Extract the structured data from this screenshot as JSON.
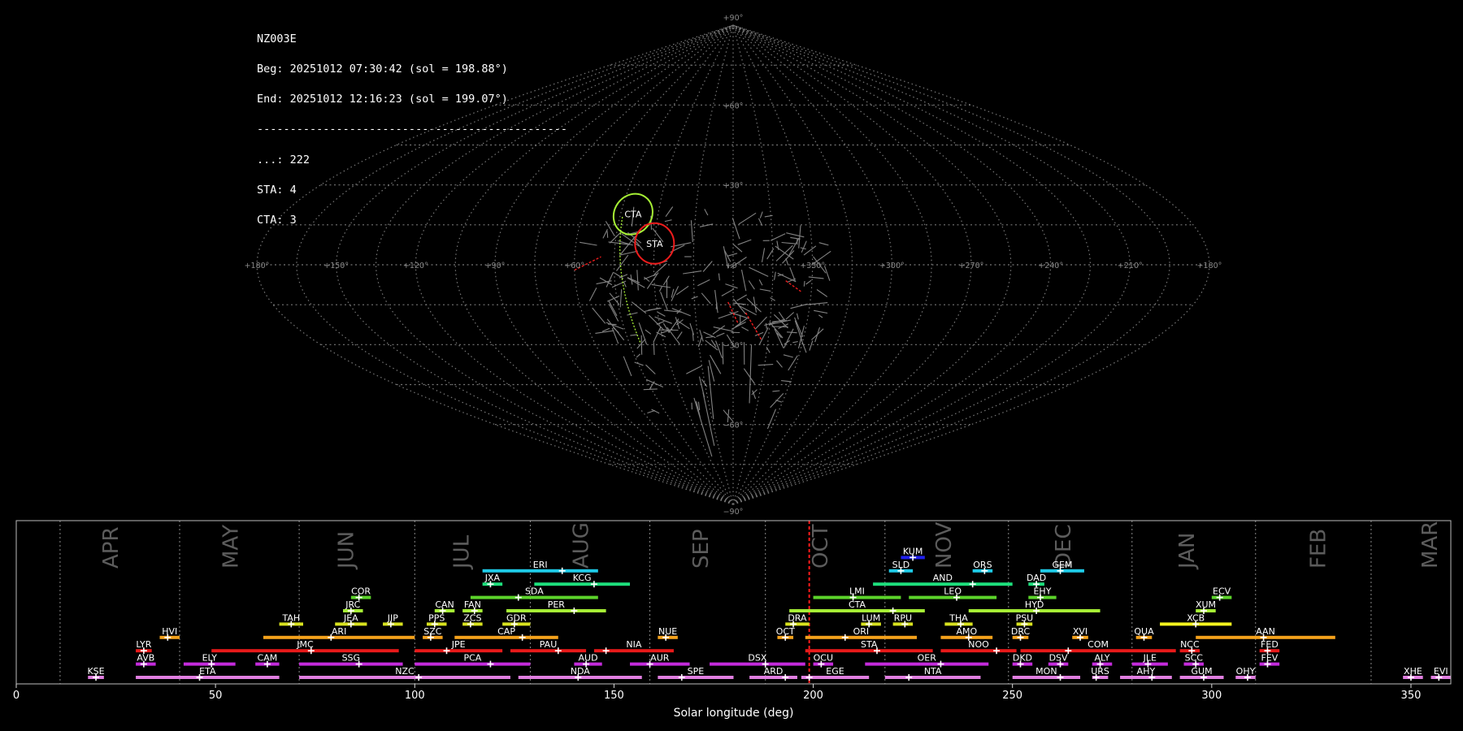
{
  "info": {
    "camera": "NZ003E",
    "begin": "Beg: 20251012 07:30:42 (sol = 198.88°)",
    "end": "End: 20251012 12:16:23 (sol = 199.07°)",
    "separator": "-----------------------------------------------",
    "sporadic": "...: 222",
    "sta": "STA: 4",
    "cta": "CTA: 3"
  },
  "colors": {
    "background": "#000000",
    "frame": "#bbbbbb",
    "grid": "#777777",
    "current_sol": "#ff1a1a",
    "month_text": "#5c5c5c",
    "trails": "#9a9a9a"
  },
  "chart_data": [
    {
      "type": "scatter",
      "projection": "sinusoidal",
      "center_longitude": 0,
      "lat_ticks": [
        {
          "value": 90,
          "label": "+90°"
        },
        {
          "value": 60,
          "label": "+60°"
        },
        {
          "value": 30,
          "label": "+30°"
        },
        {
          "value": -30,
          "label": "−30°"
        },
        {
          "value": -60,
          "label": "−60°"
        },
        {
          "value": -90,
          "label": "−90°"
        }
      ],
      "lon_ticks": [
        {
          "value": 180,
          "label": "+180°"
        },
        {
          "value": 150,
          "label": "+150°"
        },
        {
          "value": 120,
          "label": "+120°"
        },
        {
          "value": 90,
          "label": "+90°"
        },
        {
          "value": 60,
          "label": "+60°"
        },
        {
          "value": 0,
          "label": "+0°"
        },
        {
          "value": -30,
          "label": "+330°"
        },
        {
          "value": -60,
          "label": "+300°"
        },
        {
          "value": -90,
          "label": "+270°"
        },
        {
          "value": -120,
          "label": "+240°"
        },
        {
          "value": -150,
          "label": "+210°"
        },
        {
          "value": -180,
          "label": "+180°"
        }
      ],
      "grid": true,
      "radiants": [
        {
          "code": "CTA",
          "lon": 40,
          "lat": 19,
          "color": "#a6f035"
        },
        {
          "code": "STA",
          "lon": 30,
          "lat": 8,
          "color": "#ee1c1c"
        }
      ]
    },
    {
      "type": "bar",
      "orientation": "horizontal",
      "xlabel": "Solar longitude (deg)",
      "xlim": [
        0,
        360
      ],
      "x_ticks": [
        0,
        50,
        100,
        150,
        200,
        250,
        300,
        350
      ],
      "current_sol": 199.0,
      "month_boundaries": [
        11,
        41,
        71,
        100,
        129,
        159,
        188,
        218,
        249,
        280,
        311,
        340
      ],
      "months": [
        {
          "label": "APR",
          "x": 24
        },
        {
          "label": "MAY",
          "x": 54
        },
        {
          "label": "JUN",
          "x": 83
        },
        {
          "label": "JUL",
          "x": 112
        },
        {
          "label": "AUG",
          "x": 142
        },
        {
          "label": "SEP",
          "x": 172
        },
        {
          "label": "OCT",
          "x": 202
        },
        {
          "label": "NOV",
          "x": 233
        },
        {
          "label": "DEC",
          "x": 263
        },
        {
          "label": "JAN",
          "x": 294
        },
        {
          "label": "FEB",
          "x": 327
        },
        {
          "label": "MAR",
          "x": 355
        }
      ],
      "showers": [
        {
          "code": "KUM",
          "start": 222,
          "end": 228,
          "peak": 225,
          "row": 9,
          "color": "#2020ee"
        },
        {
          "code": "ERI",
          "start": 117,
          "end": 146,
          "peak": 137,
          "row": 8,
          "color": "#1ecbe8"
        },
        {
          "code": "SLD",
          "start": 219,
          "end": 225,
          "peak": 222,
          "row": 8,
          "color": "#1ecbe8"
        },
        {
          "code": "ORS",
          "start": 240,
          "end": 245,
          "peak": 243,
          "row": 8,
          "color": "#1ecbe8"
        },
        {
          "code": "GEM",
          "start": 257,
          "end": 268,
          "peak": 262,
          "row": 8,
          "color": "#1ecbe8"
        },
        {
          "code": "JXA",
          "start": 117,
          "end": 122,
          "peak": 119,
          "row": 7,
          "color": "#1de07c"
        },
        {
          "code": "KCG",
          "start": 130,
          "end": 154,
          "peak": 145,
          "row": 7,
          "color": "#1de07c"
        },
        {
          "code": "AND",
          "start": 215,
          "end": 250,
          "peak": 240,
          "row": 7,
          "color": "#1de07c"
        },
        {
          "code": "DAD",
          "start": 254,
          "end": 258,
          "peak": 256,
          "row": 7,
          "color": "#1de07c"
        },
        {
          "code": "COR",
          "start": 84,
          "end": 89,
          "peak": 86,
          "row": 6,
          "color": "#5cd32a"
        },
        {
          "code": "SDA",
          "start": 114,
          "end": 146,
          "peak": 126,
          "row": 6,
          "color": "#5cd32a"
        },
        {
          "code": "LMI",
          "start": 200,
          "end": 222,
          "peak": 210,
          "row": 6,
          "color": "#5cd32a"
        },
        {
          "code": "LEO",
          "start": 224,
          "end": 246,
          "peak": 236,
          "row": 6,
          "color": "#5cd32a"
        },
        {
          "code": "EHY",
          "start": 254,
          "end": 261,
          "peak": 257,
          "row": 6,
          "color": "#5cd32a"
        },
        {
          "code": "ECV",
          "start": 300,
          "end": 305,
          "peak": 302,
          "row": 6,
          "color": "#5cd32a"
        },
        {
          "code": "JRC",
          "start": 82,
          "end": 87,
          "peak": 84,
          "row": 5,
          "color": "#a6f035"
        },
        {
          "code": "CAN",
          "start": 105,
          "end": 110,
          "peak": 107,
          "row": 5,
          "color": "#a6f035"
        },
        {
          "code": "FAN",
          "start": 112,
          "end": 117,
          "peak": 115,
          "row": 5,
          "color": "#a6f035"
        },
        {
          "code": "PER",
          "start": 123,
          "end": 148,
          "peak": 140,
          "row": 5,
          "color": "#a6f035"
        },
        {
          "code": "CTA",
          "start": 194,
          "end": 228,
          "peak": 220,
          "row": 5,
          "color": "#a6f035"
        },
        {
          "code": "HYD",
          "start": 239,
          "end": 272,
          "peak": 256,
          "row": 5,
          "color": "#a6f035"
        },
        {
          "code": "XUM",
          "start": 296,
          "end": 301,
          "peak": 298,
          "row": 5,
          "color": "#a6f035"
        },
        {
          "code": "TAH",
          "start": 66,
          "end": 72,
          "peak": 69,
          "row": 4,
          "color": "#d8e21e"
        },
        {
          "code": "JEA",
          "start": 80,
          "end": 88,
          "peak": 84,
          "row": 4,
          "color": "#d8e21e"
        },
        {
          "code": "JIP",
          "start": 92,
          "end": 97,
          "peak": 94,
          "row": 4,
          "color": "#d8e21e"
        },
        {
          "code": "PPS",
          "start": 103,
          "end": 108,
          "peak": 105,
          "row": 4,
          "color": "#d8e21e"
        },
        {
          "code": "ZCS",
          "start": 112,
          "end": 117,
          "peak": 114,
          "row": 4,
          "color": "#d8e21e"
        },
        {
          "code": "GDR",
          "start": 122,
          "end": 129,
          "peak": 125,
          "row": 4,
          "color": "#d8e21e"
        },
        {
          "code": "DRA",
          "start": 193,
          "end": 199,
          "peak": 195,
          "row": 4,
          "color": "#d8e21e"
        },
        {
          "code": "LUM",
          "start": 212,
          "end": 217,
          "peak": 214,
          "row": 4,
          "color": "#d8e21e"
        },
        {
          "code": "RPU",
          "start": 220,
          "end": 225,
          "peak": 223,
          "row": 4,
          "color": "#d8e21e"
        },
        {
          "code": "THA",
          "start": 233,
          "end": 240,
          "peak": 237,
          "row": 4,
          "color": "#d8e21e"
        },
        {
          "code": "PSU",
          "start": 251,
          "end": 255,
          "peak": 253,
          "row": 4,
          "color": "#d8e21e"
        },
        {
          "code": "XCB",
          "start": 287,
          "end": 305,
          "peak": 296,
          "row": 4,
          "color": "#f5f51e"
        },
        {
          "code": "HVI",
          "start": 36,
          "end": 41,
          "peak": 38,
          "row": 3,
          "color": "#f5a21b"
        },
        {
          "code": "ARI",
          "start": 62,
          "end": 100,
          "peak": 79,
          "row": 3,
          "color": "#f5a21b"
        },
        {
          "code": "SZC",
          "start": 102,
          "end": 107,
          "peak": 104,
          "row": 3,
          "color": "#f5a21b"
        },
        {
          "code": "CAP",
          "start": 110,
          "end": 136,
          "peak": 127,
          "row": 3,
          "color": "#f5a21b"
        },
        {
          "code": "NUE",
          "start": 161,
          "end": 166,
          "peak": 163,
          "row": 3,
          "color": "#f5a21b"
        },
        {
          "code": "OCT",
          "start": 191,
          "end": 195,
          "peak": 193,
          "row": 3,
          "color": "#f5a21b"
        },
        {
          "code": "ORI",
          "start": 198,
          "end": 226,
          "peak": 208,
          "row": 3,
          "color": "#f5a21b"
        },
        {
          "code": "AMO",
          "start": 232,
          "end": 245,
          "peak": 239,
          "row": 3,
          "color": "#f5a21b"
        },
        {
          "code": "DRC",
          "start": 250,
          "end": 254,
          "peak": 252,
          "row": 3,
          "color": "#f5a21b"
        },
        {
          "code": "XVI",
          "start": 265,
          "end": 269,
          "peak": 267,
          "row": 3,
          "color": "#f5a21b"
        },
        {
          "code": "QUA",
          "start": 281,
          "end": 285,
          "peak": 283,
          "row": 3,
          "color": "#f5a21b"
        },
        {
          "code": "AAN",
          "start": 296,
          "end": 331,
          "peak": 313,
          "row": 3,
          "color": "#f5a21b"
        },
        {
          "code": "LYR",
          "start": 30,
          "end": 34,
          "peak": 32,
          "row": 2,
          "color": "#e81a1a"
        },
        {
          "code": "JMC",
          "start": 49,
          "end": 96,
          "peak": 74,
          "row": 2,
          "color": "#e81a1a"
        },
        {
          "code": "JPE",
          "start": 100,
          "end": 122,
          "peak": 108,
          "row": 2,
          "color": "#e81a1a"
        },
        {
          "code": "PAU",
          "start": 124,
          "end": 143,
          "peak": 136,
          "row": 2,
          "color": "#e81a1a"
        },
        {
          "code": "NIA",
          "start": 145,
          "end": 165,
          "peak": 148,
          "row": 2,
          "color": "#e81a1a"
        },
        {
          "code": "STA",
          "start": 198,
          "end": 230,
          "peak": 216,
          "row": 2,
          "color": "#e81a1a"
        },
        {
          "code": "NOO",
          "start": 232,
          "end": 251,
          "peak": 246,
          "row": 2,
          "color": "#e81a1a"
        },
        {
          "code": "COM",
          "start": 252,
          "end": 291,
          "peak": 264,
          "row": 2,
          "color": "#e81a1a"
        },
        {
          "code": "NCC",
          "start": 292,
          "end": 297,
          "peak": 295,
          "row": 2,
          "color": "#e81a1a"
        },
        {
          "code": "FED",
          "start": 312,
          "end": 317,
          "peak": 314,
          "row": 2,
          "color": "#e81a1a"
        },
        {
          "code": "AVB",
          "start": 30,
          "end": 35,
          "peak": 32,
          "row": 1,
          "color": "#c42bdc"
        },
        {
          "code": "ELY",
          "start": 42,
          "end": 55,
          "peak": 49,
          "row": 1,
          "color": "#c42bdc"
        },
        {
          "code": "CAM",
          "start": 60,
          "end": 66,
          "peak": 63,
          "row": 1,
          "color": "#c42bdc"
        },
        {
          "code": "SSG",
          "start": 71,
          "end": 97,
          "peak": 86,
          "row": 1,
          "color": "#c42bdc"
        },
        {
          "code": "PCA",
          "start": 100,
          "end": 129,
          "peak": 119,
          "row": 1,
          "color": "#c42bdc"
        },
        {
          "code": "AUD",
          "start": 140,
          "end": 147,
          "peak": 143,
          "row": 1,
          "color": "#c42bdc"
        },
        {
          "code": "AUR",
          "start": 154,
          "end": 169,
          "peak": 159,
          "row": 1,
          "color": "#c42bdc"
        },
        {
          "code": "DSX",
          "start": 174,
          "end": 198,
          "peak": 188,
          "row": 1,
          "color": "#c42bdc"
        },
        {
          "code": "OCU",
          "start": 200,
          "end": 205,
          "peak": 202,
          "row": 1,
          "color": "#c42bdc"
        },
        {
          "code": "OER",
          "start": 213,
          "end": 244,
          "peak": 232,
          "row": 1,
          "color": "#c42bdc"
        },
        {
          "code": "DKD",
          "start": 250,
          "end": 255,
          "peak": 252,
          "row": 1,
          "color": "#c42bdc"
        },
        {
          "code": "DSV",
          "start": 259,
          "end": 264,
          "peak": 262,
          "row": 1,
          "color": "#c42bdc"
        },
        {
          "code": "ALY",
          "start": 270,
          "end": 275,
          "peak": 272,
          "row": 1,
          "color": "#c42bdc"
        },
        {
          "code": "JLE",
          "start": 280,
          "end": 289,
          "peak": 284,
          "row": 1,
          "color": "#c42bdc"
        },
        {
          "code": "SCC",
          "start": 293,
          "end": 298,
          "peak": 296,
          "row": 1,
          "color": "#c42bdc"
        },
        {
          "code": "FEV",
          "start": 312,
          "end": 317,
          "peak": 314,
          "row": 1,
          "color": "#c42bdc"
        },
        {
          "code": "KSE",
          "start": 18,
          "end": 22,
          "peak": 20,
          "row": 0,
          "color": "#e07ee0"
        },
        {
          "code": "ETA",
          "start": 30,
          "end": 66,
          "peak": 46,
          "row": 0,
          "color": "#e07ee0"
        },
        {
          "code": "NZC",
          "start": 71,
          "end": 124,
          "peak": 101,
          "row": 0,
          "color": "#e07ee0"
        },
        {
          "code": "NDA",
          "start": 126,
          "end": 157,
          "peak": 141,
          "row": 0,
          "color": "#e07ee0"
        },
        {
          "code": "SPE",
          "start": 161,
          "end": 180,
          "peak": 167,
          "row": 0,
          "color": "#e07ee0"
        },
        {
          "code": "ARD",
          "start": 184,
          "end": 196,
          "peak": 193,
          "row": 0,
          "color": "#e07ee0"
        },
        {
          "code": "EGE",
          "start": 197,
          "end": 214,
          "peak": 199,
          "row": 0,
          "color": "#e07ee0"
        },
        {
          "code": "NTA",
          "start": 218,
          "end": 242,
          "peak": 224,
          "row": 0,
          "color": "#e07ee0"
        },
        {
          "code": "MON",
          "start": 250,
          "end": 267,
          "peak": 262,
          "row": 0,
          "color": "#e07ee0"
        },
        {
          "code": "URS",
          "start": 270,
          "end": 274,
          "peak": 271,
          "row": 0,
          "color": "#e07ee0"
        },
        {
          "code": "AHY",
          "start": 277,
          "end": 290,
          "peak": 285,
          "row": 0,
          "color": "#e07ee0"
        },
        {
          "code": "GUM",
          "start": 292,
          "end": 303,
          "peak": 298,
          "row": 0,
          "color": "#e07ee0"
        },
        {
          "code": "OHY",
          "start": 306,
          "end": 311,
          "peak": 309,
          "row": 0,
          "color": "#e07ee0"
        },
        {
          "code": "XHE",
          "start": 348,
          "end": 353,
          "peak": 350,
          "row": 0,
          "color": "#e07ee0"
        },
        {
          "code": "EVI",
          "start": 355,
          "end": 360,
          "peak": 357,
          "row": 0,
          "color": "#e07ee0"
        }
      ]
    }
  ]
}
